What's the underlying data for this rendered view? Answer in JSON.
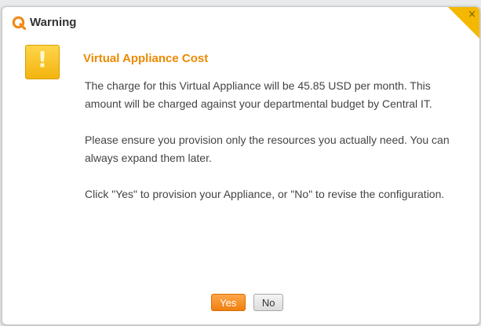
{
  "dialog": {
    "title": "Warning",
    "heading": "Virtual Appliance Cost",
    "paragraphs": [
      "The charge for this Virtual Appliance will be 45.85 USD per month.  This amount will be charged against your departmental budget by Central IT.",
      "Please ensure you provision only the resources you actually need.  You can always expand them later.",
      "Click \"Yes\" to provision your Appliance, or \"No\" to revise the configuration."
    ],
    "yes_label": "Yes",
    "no_label": "No",
    "close_glyph": "×",
    "warning_glyph": "!"
  },
  "icons": {
    "app_logo": "app-logo-icon",
    "warning": "warning-icon",
    "close": "close-icon"
  },
  "colors": {
    "accent": "#ec8a00",
    "warning": "#f5b800",
    "yes_button": "#f08a1a"
  }
}
